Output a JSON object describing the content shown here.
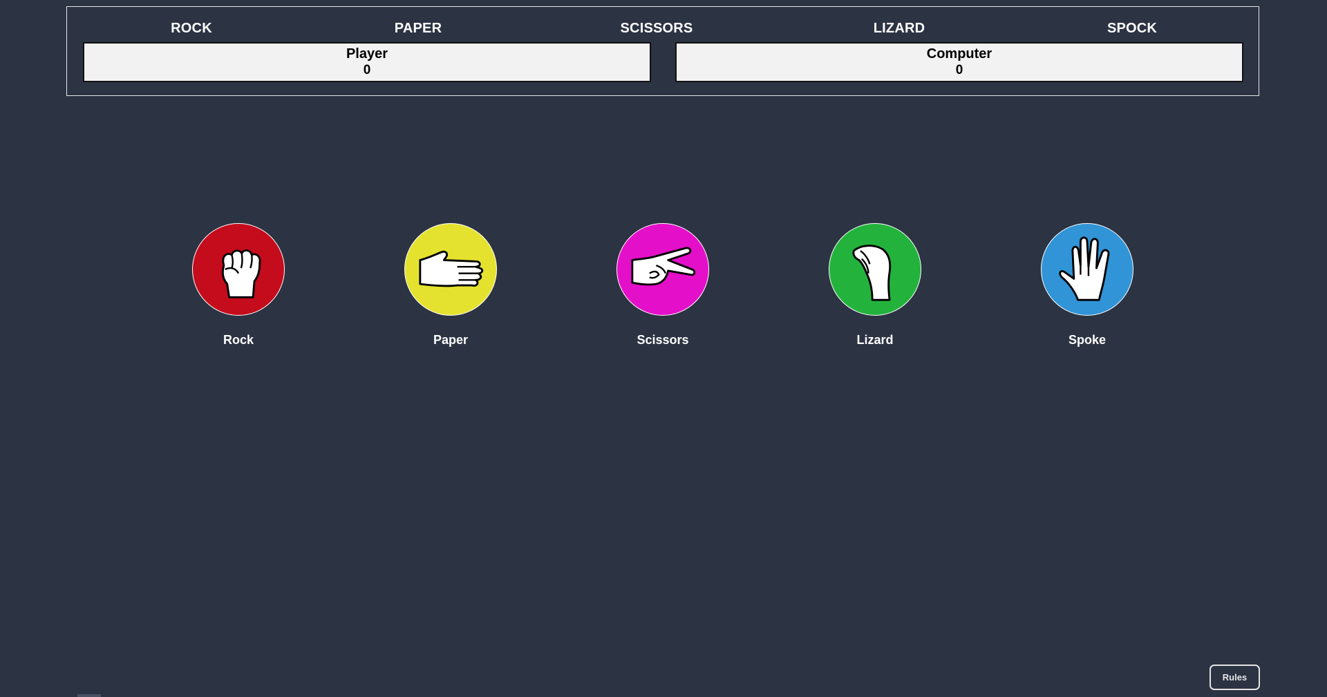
{
  "title_words": [
    "ROCK",
    "PAPER",
    "SCISSORS",
    "LIZARD",
    "SPOCK"
  ],
  "scores": {
    "player": {
      "label": "Player",
      "value": "0"
    },
    "computer": {
      "label": "Computer",
      "value": "0"
    }
  },
  "choices": [
    {
      "label": "Rock",
      "icon": "fist-icon",
      "color": "#c40c1c"
    },
    {
      "label": "Paper",
      "icon": "open-hand-icon",
      "color": "#e4e22f"
    },
    {
      "label": "Scissors",
      "icon": "scissors-hand-icon",
      "color": "#e40fc8"
    },
    {
      "label": "Lizard",
      "icon": "lizard-hand-icon",
      "color": "#23b33d"
    },
    {
      "label": "Spoke",
      "icon": "vulcan-salute-icon",
      "color": "#3194d6"
    }
  ],
  "rules_button": {
    "label": "Rules"
  }
}
